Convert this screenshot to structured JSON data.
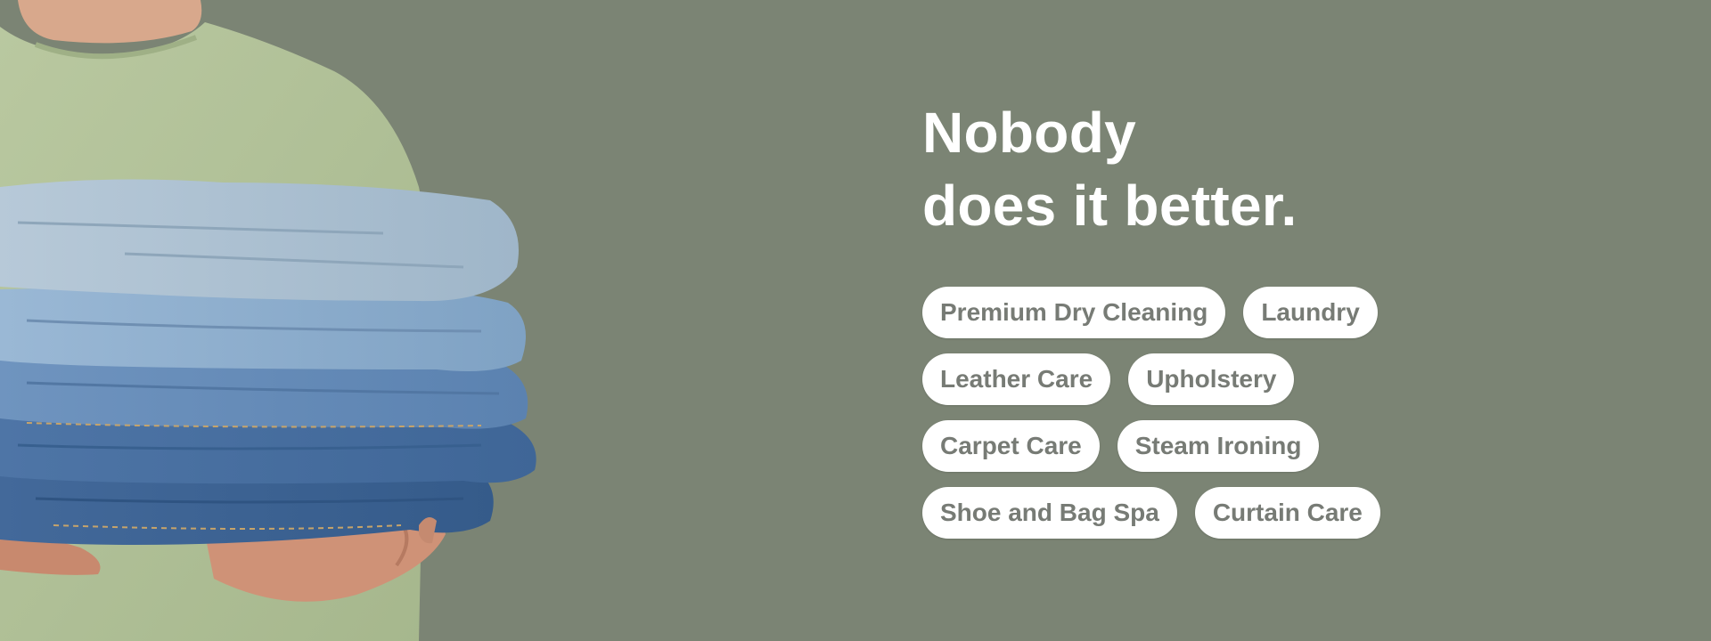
{
  "headline": {
    "line1": "Nobody",
    "line2": "does it better."
  },
  "services": [
    [
      "Premium Dry Cleaning",
      "Laundry"
    ],
    [
      "Leather Care",
      "Upholstery"
    ],
    [
      "Carpet Care",
      "Steam Ironing"
    ],
    [
      "Shoe and Bag Spa",
      "Curtain Care"
    ]
  ],
  "colors": {
    "background": "#7b8474",
    "tag_background": "#ffffff",
    "tag_text": "#777b75",
    "headline": "#ffffff"
  }
}
